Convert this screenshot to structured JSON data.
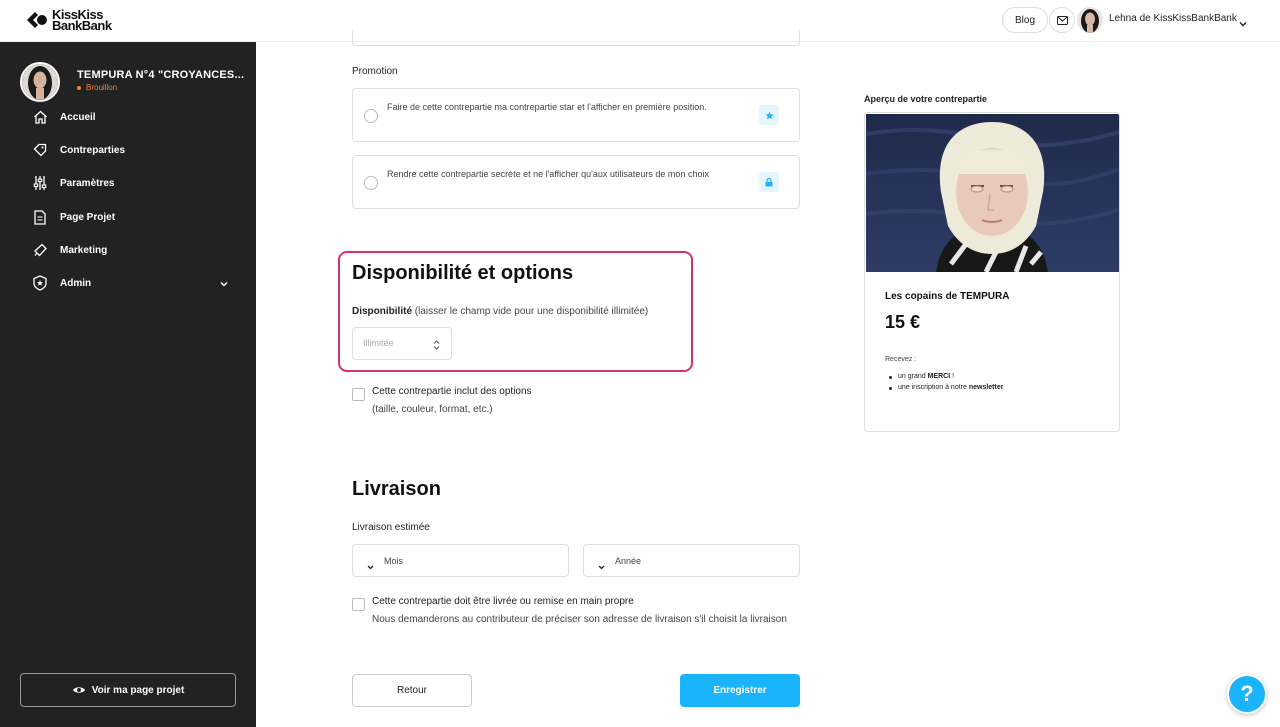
{
  "header": {
    "logo_line1": "KissKiss",
    "logo_line2": "BankBank",
    "blog_label": "Blog",
    "user_name": "Lehna de KissKissBankBank"
  },
  "sidebar": {
    "project_title": "TEMPURA N°4 \"CROYANCES...",
    "project_status": "Brouillon",
    "items": [
      {
        "label": "Accueil",
        "icon": "home-icon"
      },
      {
        "label": "Contreparties",
        "icon": "tag-icon"
      },
      {
        "label": "Paramètres",
        "icon": "sliders-icon"
      },
      {
        "label": "Page Projet",
        "icon": "document-icon"
      },
      {
        "label": "Marketing",
        "icon": "megaphone-icon"
      },
      {
        "label": "Admin",
        "icon": "shield-icon"
      }
    ],
    "view_button": "Voir ma page projet"
  },
  "form": {
    "promotion_label": "Promotion",
    "option_star": "Faire de cette contrepartie ma contrepartie star et l'afficher en première position.",
    "option_secret": "Rendre cette contrepartie secrète et ne l'afficher qu'aux utilisateurs de mon choix",
    "dispo_title": "Disponibilité et options",
    "dispo_label": "Disponibilité",
    "dispo_hint": "(laisser le champ vide pour une disponibilité illimitée)",
    "dispo_placeholder": "Illimitée",
    "options_check_label": "Cette contrepartie inclut des options",
    "options_check_sub": "(taille, couleur, format, etc.)",
    "livraison_title": "Livraison",
    "livraison_label": "Livraison estimée",
    "month_select": "Mois",
    "year_select": "Année",
    "delivery_check_label": "Cette contrepartie doit être livrée ou remise en main propre",
    "delivery_check_sub": "Nous demanderons au contributeur de préciser son adresse de livraison s'il choisit la livraison",
    "back_button": "Retour",
    "save_button": "Enregistrer"
  },
  "preview": {
    "title": "Aperçu de votre contrepartie",
    "name": "Les copains de TEMPURA",
    "price": "15 €",
    "receive_label": "Recevez :",
    "item1_pre": "un grand ",
    "item1_bold": "MERCI",
    "item1_post": " !",
    "item2_pre": "une inscription à notre ",
    "item2_bold": "newsletter"
  },
  "help_label": "?",
  "colors": {
    "accent": "#19b4fa",
    "highlight": "#d6336c",
    "status": "#ff7b2e",
    "sidebar": "#222222"
  }
}
